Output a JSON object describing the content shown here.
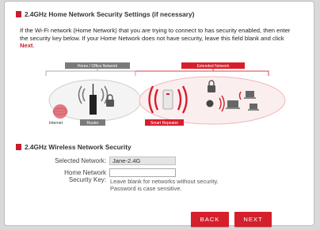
{
  "section1": {
    "title": "2.4GHz Home Network Security Settings (if necessary)",
    "intro_text": "If the Wi-Fi network (Home Network) that you are trying to connect to has security enabled, then enter the security key below. If your Home Network does not have security, leave this field blank and click ",
    "intro_link": "Next",
    "intro_end": "."
  },
  "diagram": {
    "home_label": "Home / Office Network",
    "extended_label": "Extended Network",
    "internet_label": "Internet",
    "router_label": "Router",
    "repeater_label": "Smart Repeater"
  },
  "section2": {
    "title": "2.4GHz Wireless Network Security",
    "selected_network_label": "Selected Network:",
    "selected_network_value": "Jane-2.4G",
    "home_network_label_line1": "Home Network",
    "home_network_label_line2": "Security Key:",
    "security_key_value": "",
    "help_line1": "Leave blank for networks without security.",
    "help_line2": "Password is case sensitive."
  },
  "buttons": {
    "back": "BACK",
    "next": "NEXT"
  },
  "colors": {
    "accent": "#c51f2a",
    "label_bar": "#7a7a7a",
    "extended_bar": "#d51f2c"
  }
}
